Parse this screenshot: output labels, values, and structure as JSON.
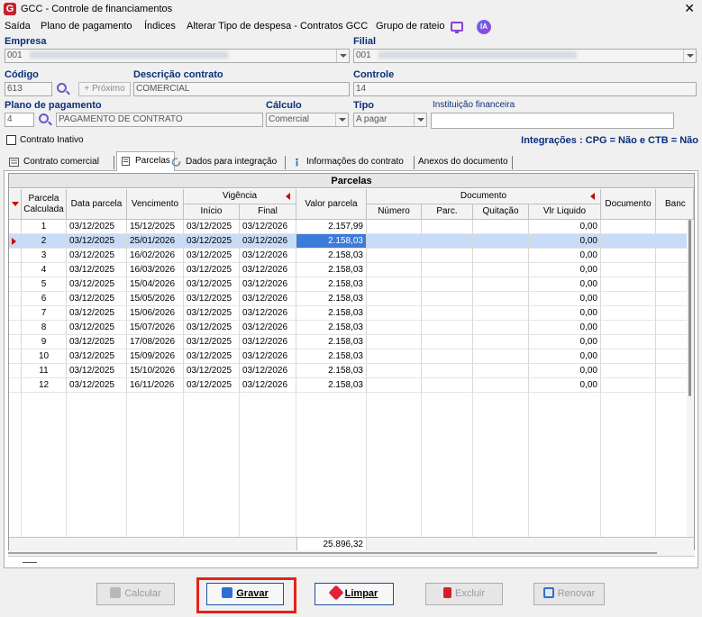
{
  "window": {
    "title": "GCC - Controle de financiamentos",
    "logo_letter": "G",
    "close_glyph": "✕"
  },
  "menu": [
    {
      "label": "Saída"
    },
    {
      "label": "Plano de pagamento"
    },
    {
      "label": "Índices"
    },
    {
      "label": "Alterar Tipo de despesa - Contratos GCC"
    },
    {
      "label": "Grupo de rateio"
    }
  ],
  "menu_ia_label": "IA",
  "form": {
    "empresa_label": "Empresa",
    "empresa_value": "001",
    "filial_label": "Filial",
    "filial_value": "001",
    "codigo_label": "Código",
    "codigo_value": "613",
    "proximo_label": "Próximo",
    "descricao_label": "Descrição contrato",
    "descricao_value": "COMERCIAL",
    "controle_label": "Controle",
    "controle_value": "14",
    "plano_label": "Plano de pagamento",
    "plano_code": "4",
    "plano_value": "PAGAMENTO DE CONTRATO",
    "calculo_label": "Cálculo",
    "calculo_value": "Comercial",
    "tipo_label": "Tipo",
    "tipo_value": "A pagar",
    "instituicao_label": "Instituição financeira",
    "instituicao_value": "",
    "inativo_label": "Contrato Inativo"
  },
  "integracoes": "Integrações : CPG = Não e CTB = Não",
  "tabs": [
    {
      "label": "Contrato comercial"
    },
    {
      "label": "Parcelas"
    },
    {
      "label": "Dados para integração"
    },
    {
      "label": "Informações do contrato"
    },
    {
      "label": "Anexos do documento"
    }
  ],
  "grid": {
    "title": "Parcelas",
    "headers": {
      "parcela": "Parcela Calculada",
      "data_parcela": "Data parcela",
      "vencimento": "Vencimento",
      "vigencia": "Vigência",
      "inicio": "Início",
      "final": "Final",
      "valor": "Valor parcela",
      "documento_group": "Documento",
      "numero": "Número",
      "parc": "Parc.",
      "quitacao": "Quitação",
      "vlr_liquido": "Vlr Liquido",
      "documento": "Documento",
      "banco": "Banc"
    },
    "rows": [
      {
        "parcela": "1",
        "data": "03/12/2025",
        "venc": "15/12/2025",
        "ini": "03/12/2025",
        "fim": "03/12/2026",
        "valor": "2.157,99",
        "liq": "0,00"
      },
      {
        "parcela": "2",
        "data": "03/12/2025",
        "venc": "25/01/2026",
        "ini": "03/12/2025",
        "fim": "03/12/2026",
        "valor": "2.158,03",
        "liq": "0,00"
      },
      {
        "parcela": "3",
        "data": "03/12/2025",
        "venc": "16/02/2026",
        "ini": "03/12/2025",
        "fim": "03/12/2026",
        "valor": "2.158,03",
        "liq": "0,00"
      },
      {
        "parcela": "4",
        "data": "03/12/2025",
        "venc": "16/03/2026",
        "ini": "03/12/2025",
        "fim": "03/12/2026",
        "valor": "2.158,03",
        "liq": "0,00"
      },
      {
        "parcela": "5",
        "data": "03/12/2025",
        "venc": "15/04/2026",
        "ini": "03/12/2025",
        "fim": "03/12/2026",
        "valor": "2.158,03",
        "liq": "0,00"
      },
      {
        "parcela": "6",
        "data": "03/12/2025",
        "venc": "15/05/2026",
        "ini": "03/12/2025",
        "fim": "03/12/2026",
        "valor": "2.158,03",
        "liq": "0,00"
      },
      {
        "parcela": "7",
        "data": "03/12/2025",
        "venc": "15/06/2026",
        "ini": "03/12/2025",
        "fim": "03/12/2026",
        "valor": "2.158,03",
        "liq": "0,00"
      },
      {
        "parcela": "8",
        "data": "03/12/2025",
        "venc": "15/07/2026",
        "ini": "03/12/2025",
        "fim": "03/12/2026",
        "valor": "2.158,03",
        "liq": "0,00"
      },
      {
        "parcela": "9",
        "data": "03/12/2025",
        "venc": "17/08/2026",
        "ini": "03/12/2025",
        "fim": "03/12/2026",
        "valor": "2.158,03",
        "liq": "0,00"
      },
      {
        "parcela": "10",
        "data": "03/12/2025",
        "venc": "15/09/2026",
        "ini": "03/12/2025",
        "fim": "03/12/2026",
        "valor": "2.158,03",
        "liq": "0,00"
      },
      {
        "parcela": "11",
        "data": "03/12/2025",
        "venc": "15/10/2026",
        "ini": "03/12/2025",
        "fim": "03/12/2026",
        "valor": "2.158,03",
        "liq": "0,00"
      },
      {
        "parcela": "12",
        "data": "03/12/2025",
        "venc": "16/11/2026",
        "ini": "03/12/2025",
        "fim": "03/12/2026",
        "valor": "2.158,03",
        "liq": "0,00"
      }
    ],
    "selected_row": 1,
    "total": "25.896,32"
  },
  "buttons": {
    "calcular": "Calcular",
    "gravar": "Gravar",
    "limpar": "Limpar",
    "excluir": "Excluir",
    "renovar": "Renovar"
  },
  "colors": {
    "accent": "#0b2f7a",
    "selection": "#3c7bd9",
    "highlight": "#e2231a"
  }
}
